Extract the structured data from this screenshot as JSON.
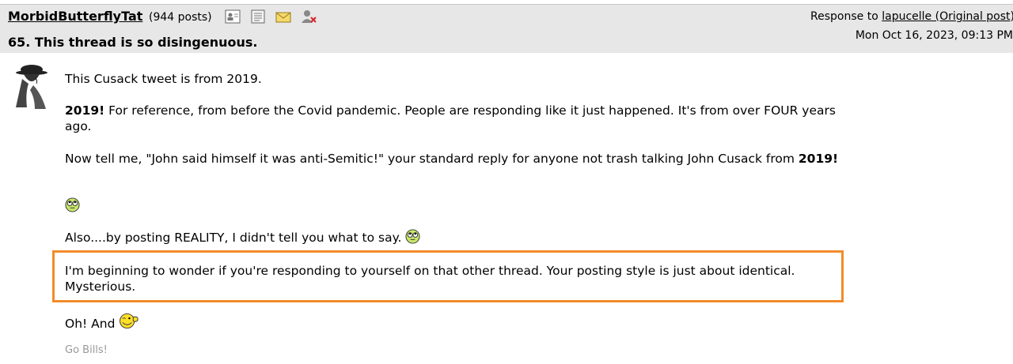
{
  "post": {
    "author": "MorbidButterflyTat",
    "post_count": "(944 posts)",
    "number_title": "65. This thread is so disingenuous.",
    "response_prefix": "Response to ",
    "response_link": "lapucelle (Original post)",
    "date": "Mon Oct 16, 2023, 09:13 PM"
  },
  "icons": [
    "profile-icon",
    "journal-icon",
    "email-icon",
    "ignore-icon"
  ],
  "body": {
    "p1": "This Cusack tweet is from 2019.",
    "p2_bold": "2019!",
    "p2_rest": " For reference, from before the Covid pandemic. People are responding like it just happened. It's from over FOUR years ago.",
    "p3": "Now tell me, \"John said himself it was anti-Semitic!\" your standard reply for anyone not trash talking John Cusack from ",
    "p3_bold": "2019!",
    "p4": "Also....by posting REALITY, I didn't tell you what to say. ",
    "p5": "I'm beginning to wonder if you're responding to yourself on that other thread. Your posting style is just about identical. Mysterious.",
    "p6": "Oh! And ",
    "signature": "Go Bills!"
  }
}
